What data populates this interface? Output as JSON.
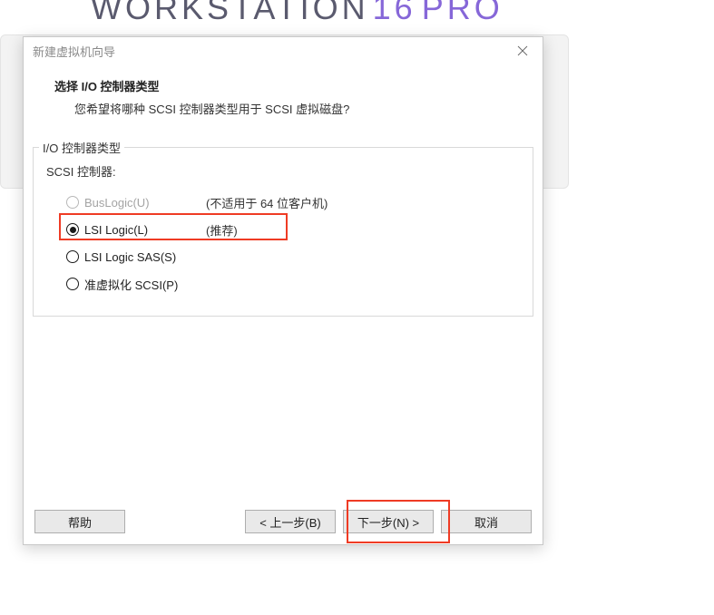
{
  "brand": {
    "name": "WORKSTATION",
    "ver": "16",
    "edition": "PRO"
  },
  "dialog": {
    "title": "新建虚拟机向导",
    "heading": "选择 I/O 控制器类型",
    "subheading": "您希望将哪种 SCSI 控制器类型用于 SCSI 虚拟磁盘?"
  },
  "group": {
    "legend": "I/O 控制器类型",
    "controllerLabel": "SCSI 控制器:",
    "options": [
      {
        "label": "BusLogic(U)",
        "note": "(不适用于 64 位客户机)",
        "checked": false,
        "disabled": true
      },
      {
        "label": "LSI Logic(L)",
        "note": "(推荐)",
        "checked": true,
        "disabled": false
      },
      {
        "label": "LSI Logic SAS(S)",
        "note": "",
        "checked": false,
        "disabled": false
      },
      {
        "label": "准虚拟化 SCSI(P)",
        "note": "",
        "checked": false,
        "disabled": false
      }
    ]
  },
  "buttons": {
    "help": "帮助",
    "back": "< 上一步(B)",
    "next": "下一步(N) >",
    "cancel": "取消"
  }
}
